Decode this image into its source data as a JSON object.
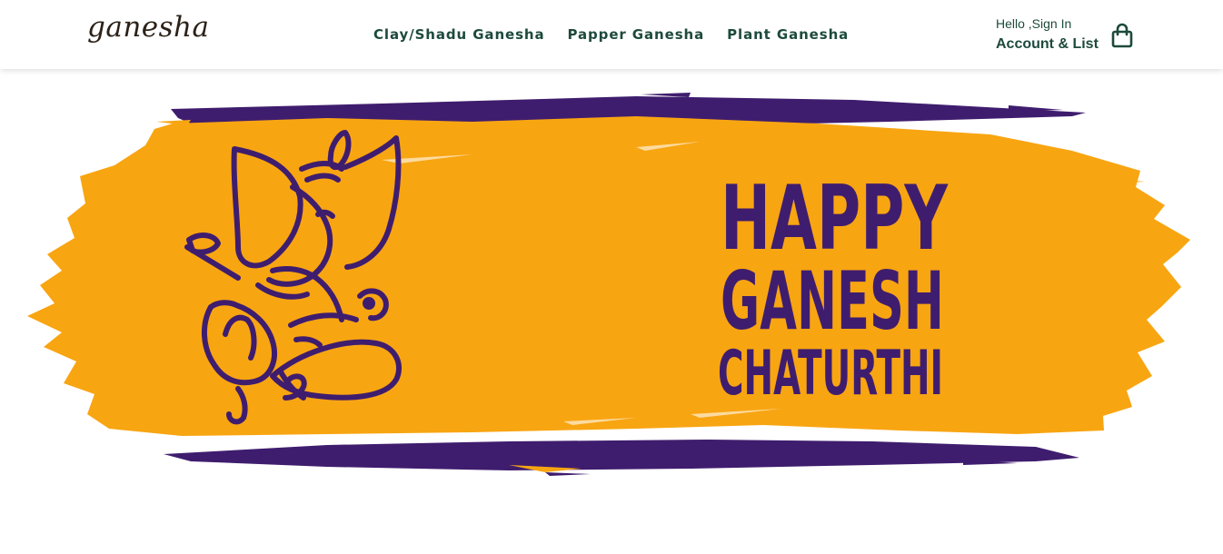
{
  "header": {
    "logo_text": "ganesha",
    "nav": [
      {
        "label": "Clay/Shadu Ganesha"
      },
      {
        "label": "Papper Ganesha"
      },
      {
        "label": "Plant Ganesha"
      }
    ],
    "account": {
      "greeting": "Hello ,Sign In",
      "label": "Account & List"
    },
    "cart_icon": "shopping-bag-icon"
  },
  "hero": {
    "line1": "HAPPY",
    "line2": "GANESH",
    "line3": "CHATURTHI",
    "illustration": "ganesha-outline-icon"
  },
  "colors": {
    "brand_green": "#1d4a3c",
    "banner_orange": "#f8a512",
    "banner_purple": "#3f1d6e"
  }
}
